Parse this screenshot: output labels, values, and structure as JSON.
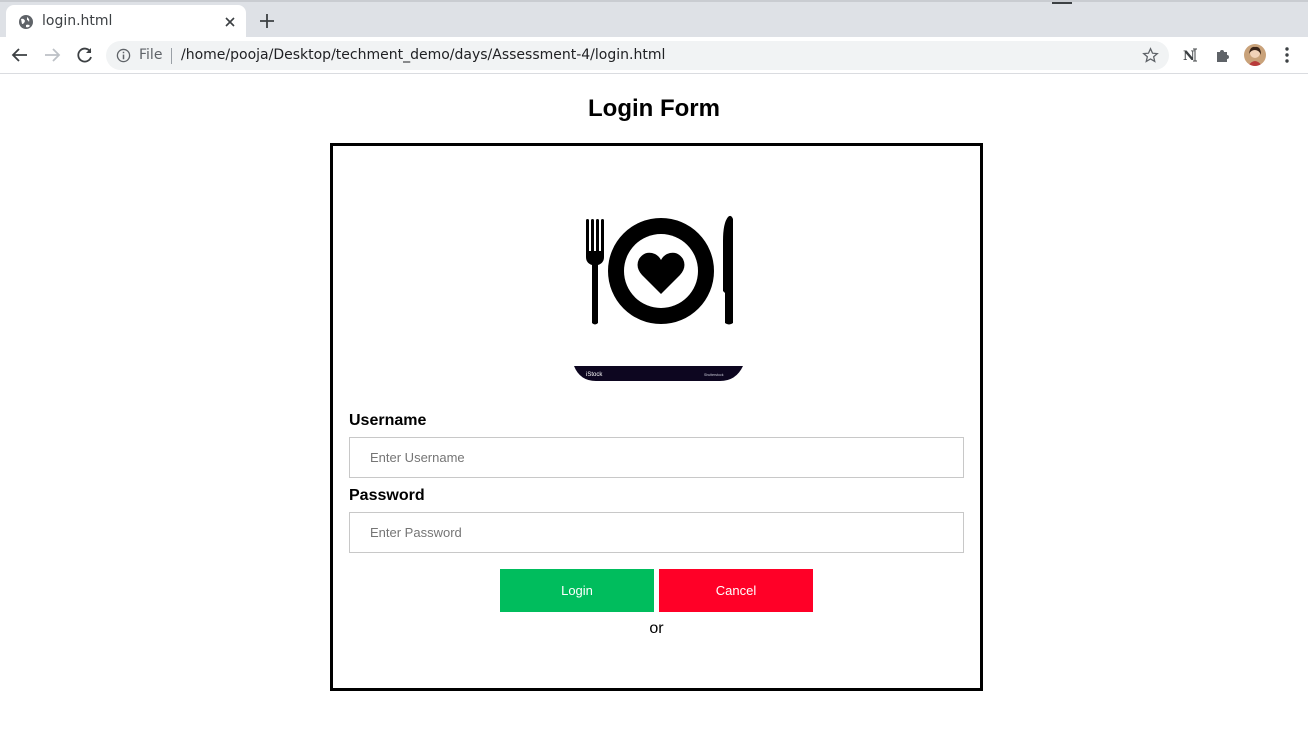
{
  "browser": {
    "tab": {
      "title": "login.html",
      "favicon": "globe-icon"
    },
    "address_bar": {
      "scheme_label": "File",
      "url": "/home/pooja/Desktop/techment_demo/days/Assessment-4/login.html"
    },
    "icons": [
      "back-arrow-icon",
      "forward-arrow-icon",
      "reload-icon",
      "info-icon",
      "star-icon",
      "notion-extension-icon",
      "puzzle-extensions-icon",
      "profile-avatar",
      "more-menu-icon",
      "close-icon",
      "plus-icon"
    ]
  },
  "page": {
    "title": "Login Form",
    "logo": {
      "name": "plate-heart-fork-knife-logo",
      "watermark_left": "iStock",
      "watermark_right": "Shutterstock"
    },
    "username": {
      "label": "Username",
      "placeholder": "Enter Username",
      "value": ""
    },
    "password": {
      "label": "Password",
      "placeholder": "Enter Password",
      "value": ""
    },
    "buttons": {
      "login": "Login",
      "cancel": "Cancel"
    },
    "or_text": "or"
  },
  "colors": {
    "login_button": "#00bd5d",
    "cancel_button": "#ff0027",
    "tab_strip": "#dee1e6",
    "omnibox": "#f1f3f4",
    "box_border": "#000000"
  }
}
